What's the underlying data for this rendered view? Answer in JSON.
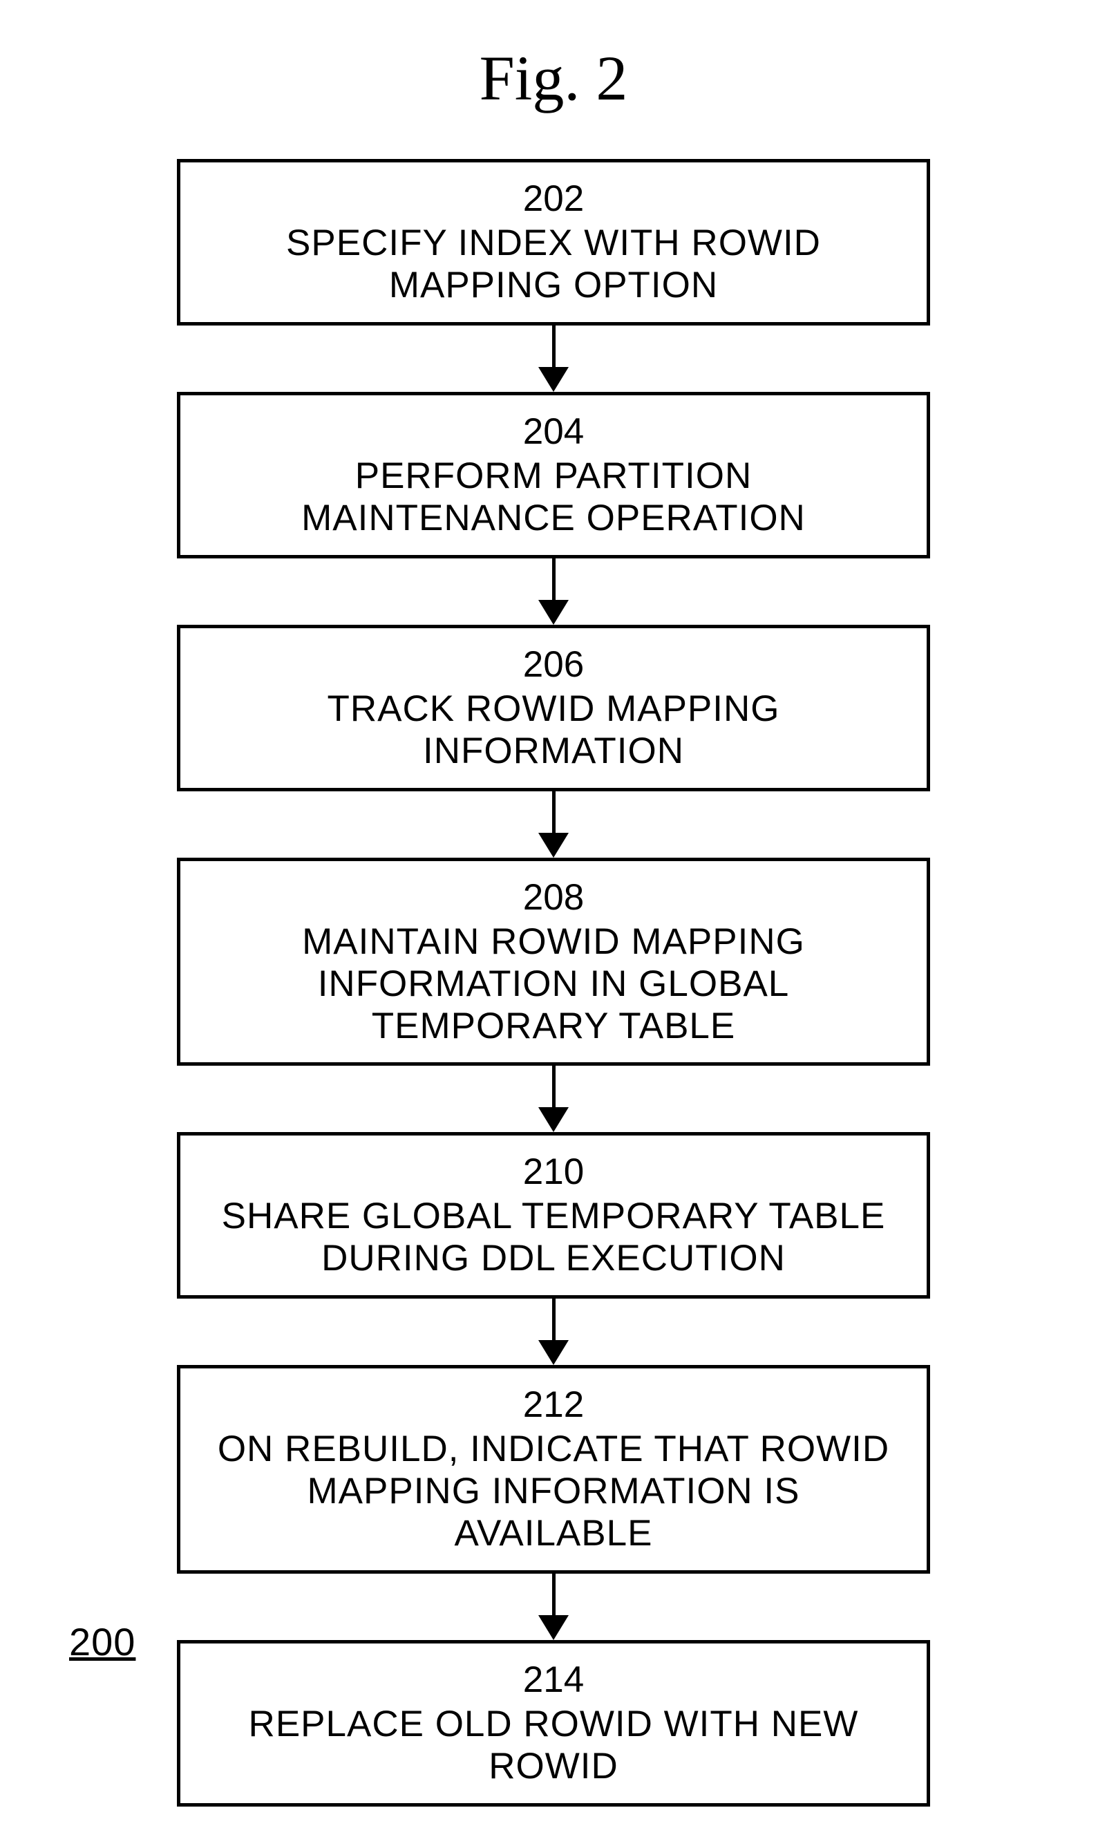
{
  "title": "Fig. 2",
  "ref_label": "200",
  "steps": [
    {
      "num": "202",
      "text": "SPECIFY INDEX WITH ROWID MAPPING OPTION"
    },
    {
      "num": "204",
      "text": "PERFORM PARTITION MAINTENANCE OPERATION"
    },
    {
      "num": "206",
      "text": "TRACK ROWID MAPPING INFORMATION"
    },
    {
      "num": "208",
      "text": "MAINTAIN ROWID MAPPING INFORMATION IN GLOBAL TEMPORARY TABLE"
    },
    {
      "num": "210",
      "text": "SHARE GLOBAL TEMPORARY TABLE DURING DDL EXECUTION"
    },
    {
      "num": "212",
      "text": "ON REBUILD, INDICATE THAT ROWID MAPPING INFORMATION IS AVAILABLE"
    },
    {
      "num": "214",
      "text": "REPLACE OLD ROWID WITH NEW ROWID"
    }
  ]
}
